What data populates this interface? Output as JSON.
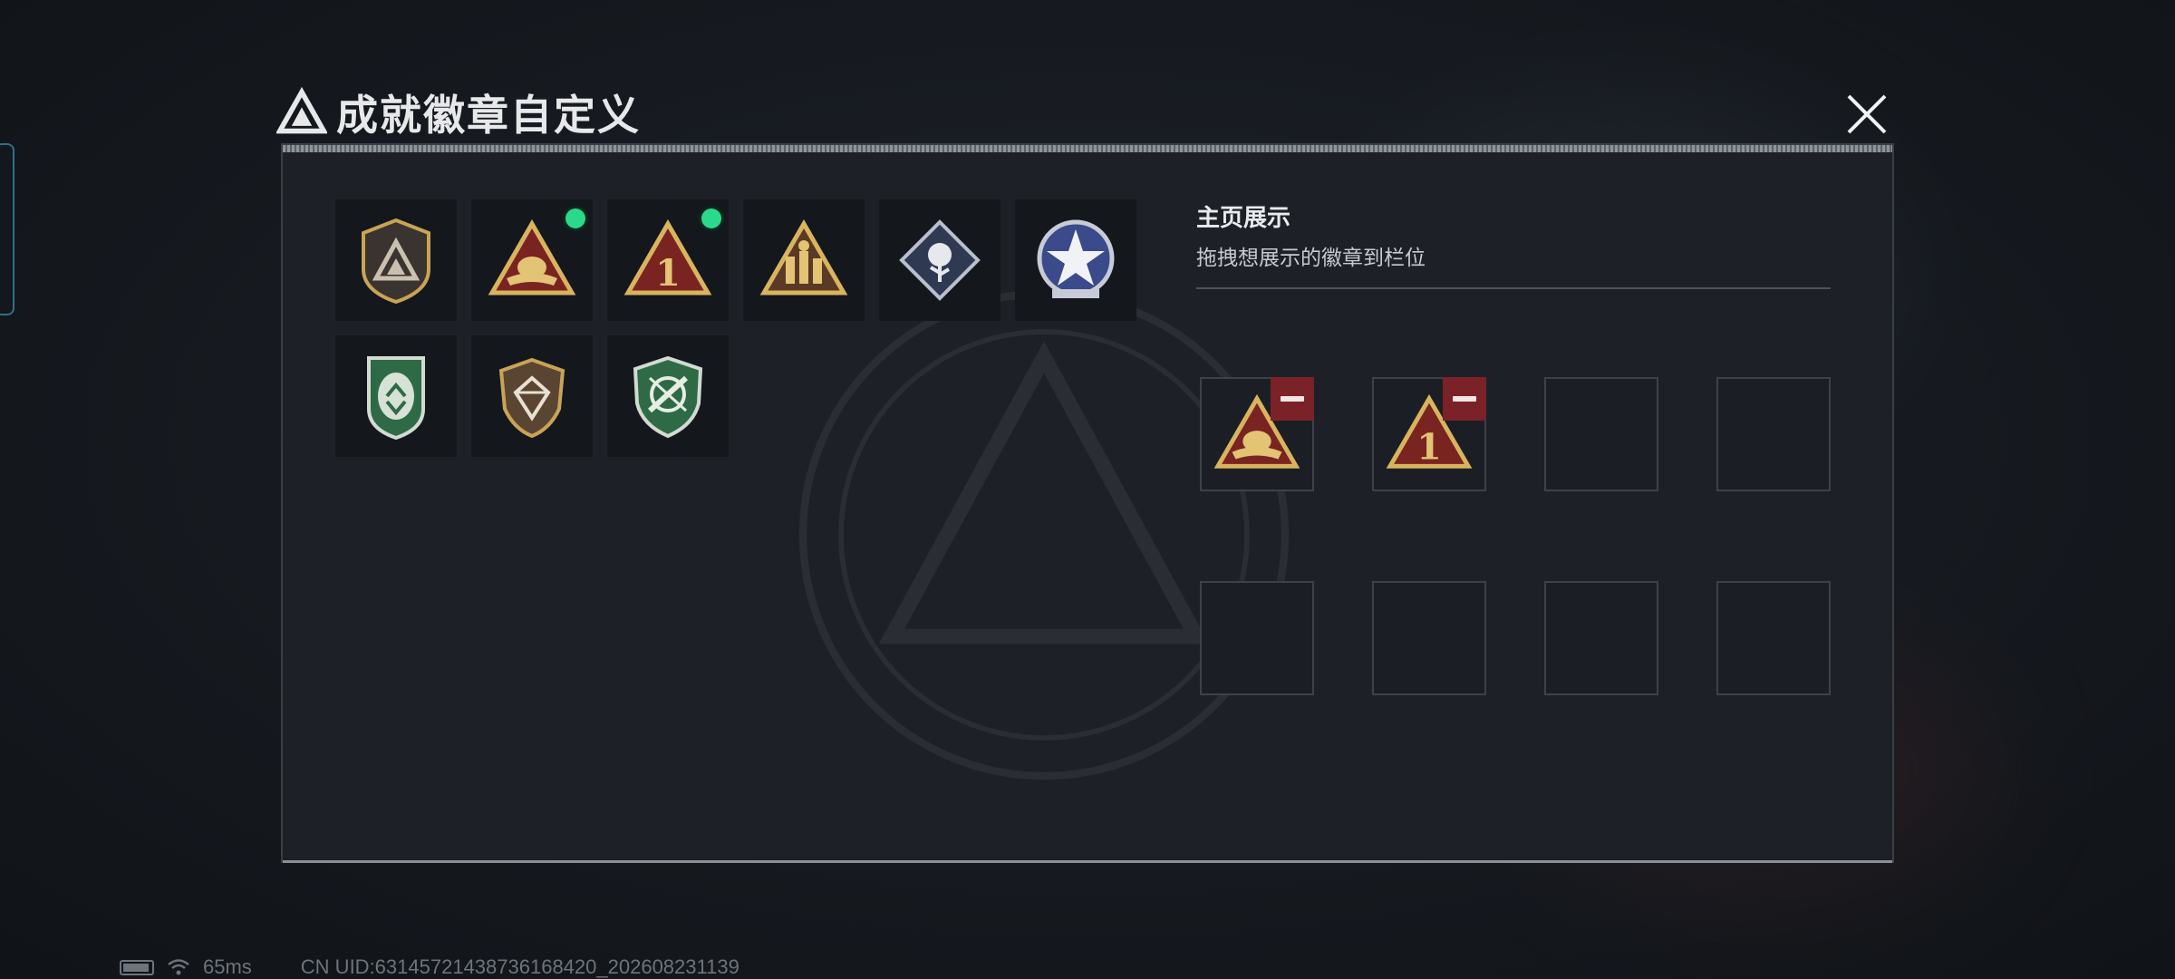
{
  "header": {
    "title": "成就徽章自定义",
    "logo_icon": "triangle-emblem-icon",
    "close_icon": "close-icon"
  },
  "badges": [
    {
      "name": "triangle-shield-badge",
      "new": false
    },
    {
      "name": "gold-hands-triangle-badge",
      "new": true
    },
    {
      "name": "number-one-triangle-badge",
      "new": true
    },
    {
      "name": "soldiers-triangle-badge",
      "new": false
    },
    {
      "name": "rose-diamond-badge",
      "new": false
    },
    {
      "name": "blue-star-roundel-badge",
      "new": false
    },
    {
      "name": "green-arrows-shield-badge",
      "new": false
    },
    {
      "name": "gem-shield-badge",
      "new": false
    },
    {
      "name": "green-crossed-shield-badge",
      "new": false
    }
  ],
  "showcase": {
    "title": "主页展示",
    "subtitle": "拖拽想展示的徽章到栏位",
    "slots": [
      {
        "badge": "gold-hands-triangle-badge",
        "remove_icon": "minus-icon"
      },
      {
        "badge": "number-one-triangle-badge",
        "remove_icon": "minus-icon"
      },
      {
        "badge": null
      },
      {
        "badge": null
      },
      {
        "badge": null
      },
      {
        "badge": null
      },
      {
        "badge": null
      },
      {
        "badge": null
      }
    ]
  },
  "number_one_label": "1",
  "status": {
    "battery_icon": "battery-icon",
    "wifi_icon": "wifi-icon",
    "ping": "65ms",
    "uid": "CN UID:63145721438736168420_202608231139"
  },
  "colors": {
    "accent_new": "#2bd98a",
    "remove_red": "#7b2128",
    "gold": "#c9a356",
    "panel": "#1d2127"
  }
}
